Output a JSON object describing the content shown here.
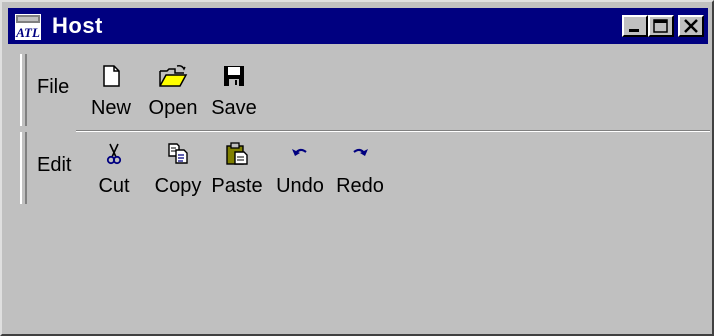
{
  "window": {
    "title": "Host",
    "app_icon": "app-icon",
    "controls": [
      "minimize-icon",
      "maximize-icon",
      "close-icon"
    ]
  },
  "toolbar": {
    "bands": [
      {
        "label": "File",
        "tools": [
          {
            "label": "New",
            "icon": "new-document-icon"
          },
          {
            "label": "Open",
            "icon": "open-folder-icon"
          },
          {
            "label": "Save",
            "icon": "save-disk-icon"
          }
        ]
      },
      {
        "label": "Edit",
        "tools": [
          {
            "label": "Cut",
            "icon": "scissors-icon"
          },
          {
            "label": "Copy",
            "icon": "copy-icon"
          },
          {
            "label": "Paste",
            "icon": "paste-clipboard-icon"
          },
          {
            "label": "Undo",
            "icon": "undo-icon"
          },
          {
            "label": "Redo",
            "icon": "redo-icon"
          }
        ]
      }
    ]
  },
  "colors": {
    "titlebar": "#000080",
    "face": "#c0c0c0",
    "icon_blue": "#000080",
    "folder_yellow": "#ffff00"
  }
}
